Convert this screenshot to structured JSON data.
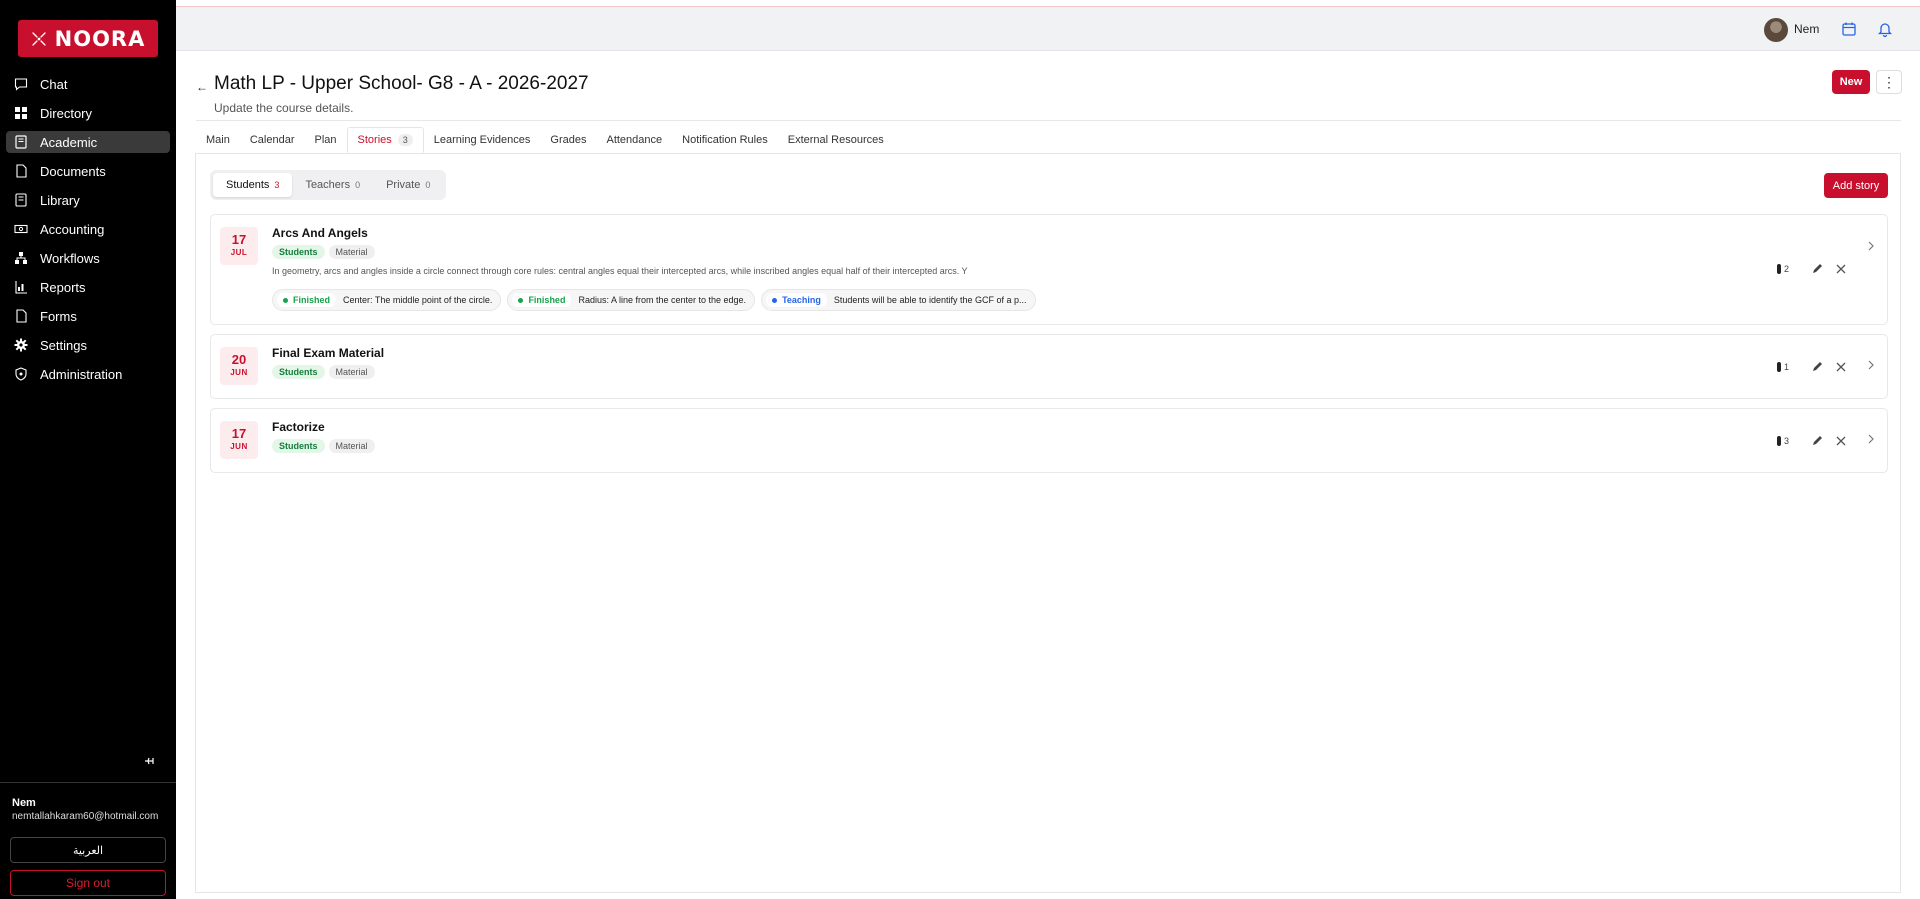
{
  "brand": {
    "name": "NOORA",
    "color": "#c8102e"
  },
  "sidebar": {
    "items": [
      {
        "label": "Chat",
        "icon": "chat-icon"
      },
      {
        "label": "Directory",
        "icon": "grid-icon"
      },
      {
        "label": "Academic",
        "icon": "book-icon",
        "active": true
      },
      {
        "label": "Documents",
        "icon": "document-icon"
      },
      {
        "label": "Library",
        "icon": "library-icon"
      },
      {
        "label": "Accounting",
        "icon": "money-icon"
      },
      {
        "label": "Workflows",
        "icon": "workflow-icon"
      },
      {
        "label": "Reports",
        "icon": "reports-icon"
      },
      {
        "label": "Forms",
        "icon": "form-icon"
      },
      {
        "label": "Settings",
        "icon": "gear-icon"
      },
      {
        "label": "Administration",
        "icon": "shield-icon"
      }
    ],
    "user": {
      "name": "Nem",
      "email": "nemtallahkaram60@hotmail.com"
    },
    "language_button": "العربية",
    "signout": "Sign out"
  },
  "topbar": {
    "user": "Nem"
  },
  "page": {
    "title": "Math LP - Upper School- G8 - A - 2026-2027",
    "subtitle": "Update the course details.",
    "new_button": "New"
  },
  "tabs": [
    {
      "label": "Main"
    },
    {
      "label": "Calendar"
    },
    {
      "label": "Plan"
    },
    {
      "label": "Stories",
      "badge": "3",
      "active": true
    },
    {
      "label": "Learning Evidences"
    },
    {
      "label": "Grades"
    },
    {
      "label": "Attendance"
    },
    {
      "label": "Notification Rules"
    },
    {
      "label": "External Resources"
    }
  ],
  "segments": [
    {
      "label": "Students",
      "count": "3",
      "active": true
    },
    {
      "label": "Teachers",
      "count": "0"
    },
    {
      "label": "Private",
      "count": "0"
    }
  ],
  "add_story": "Add story",
  "stories": [
    {
      "day": "17",
      "month": "JUL",
      "title": "Arcs And Angels",
      "tags": [
        "Students",
        "Material"
      ],
      "description": "In geometry, arcs and angles inside a circle connect through core rules: central angles equal their intercepted arcs, while inscribed angles equal half of their intercepted arcs. Y",
      "objectives": [
        {
          "status": "Finished",
          "text": "Center: The middle point of the circle."
        },
        {
          "status": "Finished",
          "text": "Radius: A line from the center to the edge."
        },
        {
          "status": "Teaching",
          "text": "Students will be able to identify the GCF of a p..."
        }
      ],
      "count": "2"
    },
    {
      "day": "20",
      "month": "JUN",
      "title": "Final Exam Material",
      "tags": [
        "Students",
        "Material"
      ],
      "count": "1"
    },
    {
      "day": "17",
      "month": "JUN",
      "title": "Factorize",
      "tags": [
        "Students",
        "Material"
      ],
      "count": "3"
    }
  ]
}
